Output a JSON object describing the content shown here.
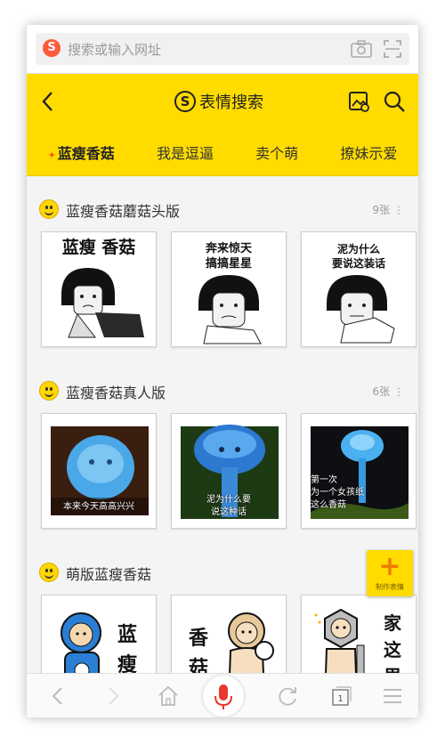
{
  "address_bar": {
    "placeholder": "搜索或输入网址"
  },
  "header": {
    "title": "表情搜索",
    "logo_letter": "S"
  },
  "tabs": [
    {
      "label": "蓝瘦香菇",
      "active": true
    },
    {
      "label": "我是逗逼",
      "active": false
    },
    {
      "label": "卖个萌",
      "active": false
    },
    {
      "label": "撩妹示爱",
      "active": false
    }
  ],
  "sections": [
    {
      "title": "蓝瘦香菇蘑菇头版",
      "count": "9张",
      "cards": [
        {
          "caption": "蓝瘦 香菇"
        },
        {
          "caption_line1": "奔来惊天",
          "caption_line2": "搞搞星星"
        },
        {
          "caption_line1": "泥为什么",
          "caption_line2": "要说这装话"
        }
      ]
    },
    {
      "title": "蓝瘦香菇真人版",
      "count": "6张",
      "cards": [
        {
          "caption": "本来今天高高兴兴"
        },
        {
          "caption_line1": "泥为什么要",
          "caption_line2": "说这种话"
        },
        {
          "caption_line1": "第一次",
          "caption_line2": "为一个女孩纸",
          "caption_line3": "这么香菇"
        }
      ]
    },
    {
      "title": "萌版蓝瘦香菇",
      "count": "",
      "cards": [
        {
          "caption_line1": "蓝",
          "caption_line2": "瘦"
        },
        {
          "caption_line1": "香",
          "caption_line2": "菇"
        },
        {
          "caption_line1": "家",
          "caption_line2": "这",
          "caption_line3": "里"
        }
      ]
    }
  ],
  "fab": {
    "symbol": "+",
    "label": "制作表情"
  },
  "colors": {
    "header_yellow": "#ffdb00",
    "accent_orange": "#ff5a00",
    "mic_red": "#e8372c"
  }
}
